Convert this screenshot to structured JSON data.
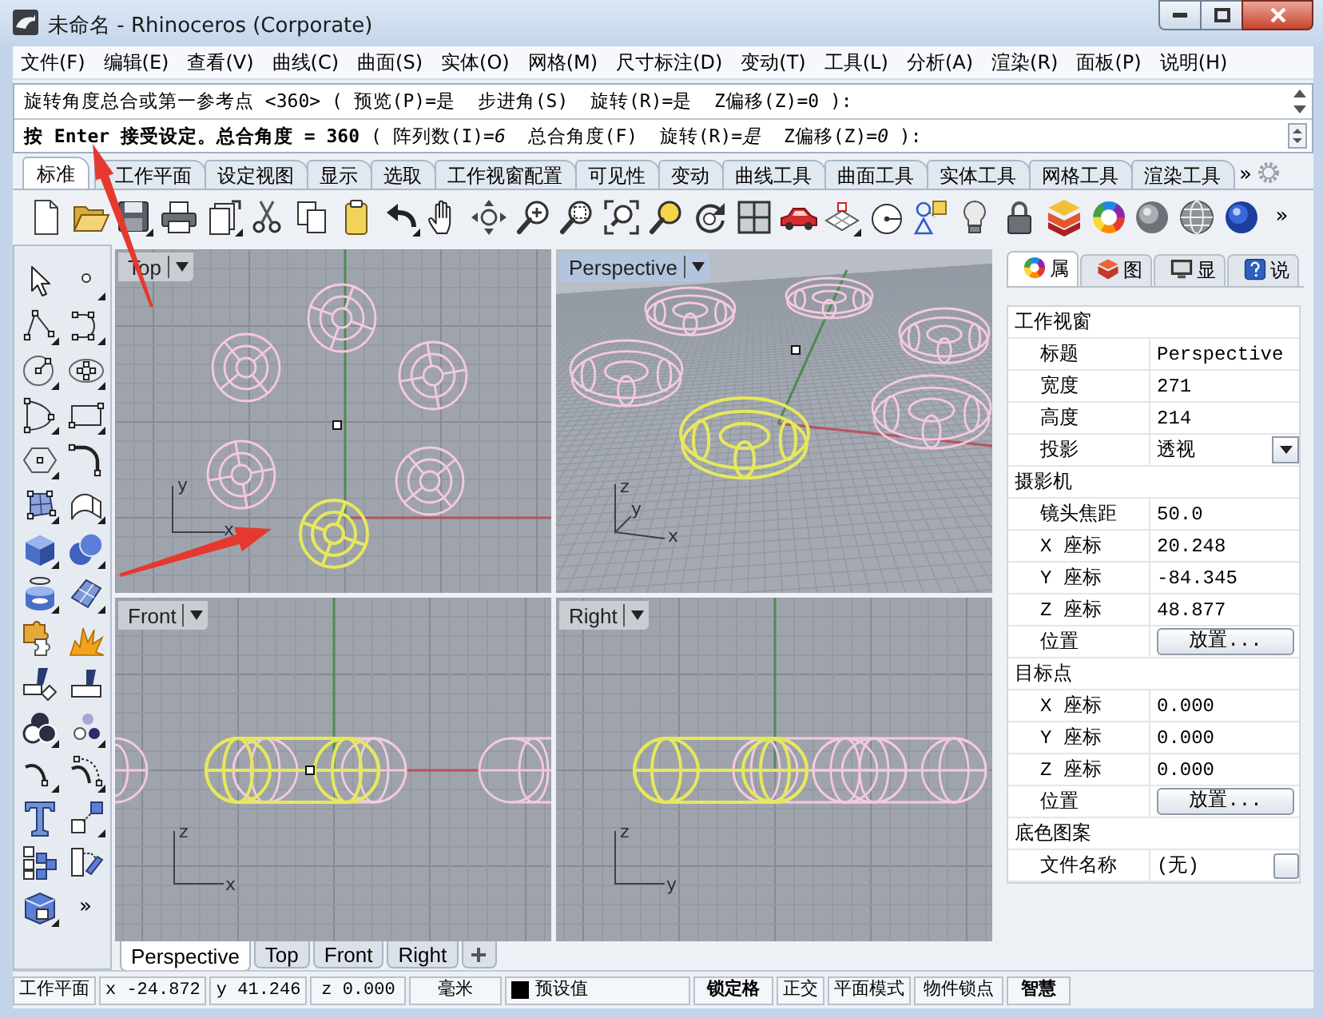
{
  "window": {
    "title": "未命名 - Rhinoceros (Corporate)"
  },
  "menu": [
    "文件(F)",
    "编辑(E)",
    "查看(V)",
    "曲线(C)",
    "曲面(S)",
    "实体(O)",
    "网格(M)",
    "尺寸标注(D)",
    "变动(T)",
    "工具(L)",
    "分析(A)",
    "渲染(R)",
    "面板(P)",
    "说明(H)"
  ],
  "command": {
    "history": "旋转角度总合或第一参考点 <360> ( 预览(P)=是  步进角(S)  旋转(R)=是  Z偏移(Z)=0 ):",
    "prompt": "**按 Enter 接受设定。总合角度 = 360** ( 阵列数(I)=*6*  总合角度(F)  旋转(R)=*是*  Z偏移(Z)=*0* ):"
  },
  "toolbar_tabs": {
    "tabs": [
      {
        "label": "标准",
        "selected": true
      },
      {
        "label": "工作平面",
        "selected": false
      },
      {
        "label": "设定视图",
        "selected": false
      },
      {
        "label": "显示",
        "selected": false
      },
      {
        "label": "选取",
        "selected": false
      },
      {
        "label": "工作视窗配置",
        "selected": false
      },
      {
        "label": "可见性",
        "selected": false
      },
      {
        "label": "变动",
        "selected": false
      },
      {
        "label": "曲线工具",
        "selected": false
      },
      {
        "label": "曲面工具",
        "selected": false
      },
      {
        "label": "实体工具",
        "selected": false
      },
      {
        "label": "网格工具",
        "selected": false
      },
      {
        "label": "渲染工具",
        "selected": false
      }
    ],
    "overflow": "»"
  },
  "toolbar": {
    "overflow": "»"
  },
  "left_toolbar": {
    "overflow": "»"
  },
  "viewports": [
    {
      "kind": "top",
      "title": "Top",
      "active": false,
      "axes": [
        "y",
        "x"
      ]
    },
    {
      "kind": "perspective",
      "title": "Perspective",
      "active": true,
      "axes": [
        "z",
        "y",
        "x"
      ]
    },
    {
      "kind": "front",
      "title": "Front",
      "active": false,
      "axes": [
        "z",
        "x"
      ]
    },
    {
      "kind": "right",
      "title": "Right",
      "active": false,
      "axes": [
        "z",
        "y"
      ]
    }
  ],
  "viewport_tabs": [
    {
      "label": "Perspective",
      "selected": true
    },
    {
      "label": "Top",
      "selected": false
    },
    {
      "label": "Front",
      "selected": false
    },
    {
      "label": "Right",
      "selected": false
    }
  ],
  "panel": {
    "tabs": [
      {
        "label": "属",
        "selected": true
      },
      {
        "label": "图",
        "selected": false
      },
      {
        "label": "显",
        "selected": false
      },
      {
        "label": "说",
        "selected": false
      }
    ],
    "sections": [
      {
        "title": "工作视窗",
        "rows": [
          {
            "label": "标题",
            "value": "Perspective",
            "kind": "text"
          },
          {
            "label": "宽度",
            "value": "271",
            "kind": "text"
          },
          {
            "label": "高度",
            "value": "214",
            "kind": "text"
          },
          {
            "label": "投影",
            "value": "透视",
            "kind": "dropdown"
          }
        ]
      },
      {
        "title": "摄影机",
        "rows": [
          {
            "label": "镜头焦距",
            "value": "50.0",
            "kind": "text"
          },
          {
            "label": "X 座标",
            "value": "20.248",
            "kind": "text"
          },
          {
            "label": "Y 座标",
            "value": "-84.345",
            "kind": "text"
          },
          {
            "label": "Z 座标",
            "value": "48.877",
            "kind": "text"
          },
          {
            "label": "位置",
            "value": "放置...",
            "kind": "button"
          }
        ]
      },
      {
        "title": "目标点",
        "rows": [
          {
            "label": "X 座标",
            "value": "0.000",
            "kind": "text"
          },
          {
            "label": "Y 座标",
            "value": "0.000",
            "kind": "text"
          },
          {
            "label": "Z 座标",
            "value": "0.000",
            "kind": "text"
          },
          {
            "label": "位置",
            "value": "放置...",
            "kind": "button"
          }
        ]
      },
      {
        "title": "底色图案",
        "rows": [
          {
            "label": "文件名称",
            "value": "(无)",
            "kind": "file"
          }
        ]
      }
    ]
  },
  "status_bar": [
    {
      "kind": "field",
      "text": "工作平面"
    },
    {
      "kind": "field",
      "text": "x -24.872"
    },
    {
      "kind": "field",
      "text": "y 41.246"
    },
    {
      "kind": "field",
      "text": "z 0.000"
    },
    {
      "kind": "field",
      "text": "毫米"
    },
    {
      "kind": "layer",
      "text": "预设值",
      "color": "#000000"
    },
    {
      "kind": "toggle",
      "text": "锁定格",
      "on": true
    },
    {
      "kind": "toggle",
      "text": "正交",
      "on": false
    },
    {
      "kind": "toggle",
      "text": "平面模式",
      "on": false
    },
    {
      "kind": "toggle",
      "text": "物件锁点",
      "on": false
    },
    {
      "kind": "toggle",
      "text": "智慧",
      "on": true
    }
  ]
}
